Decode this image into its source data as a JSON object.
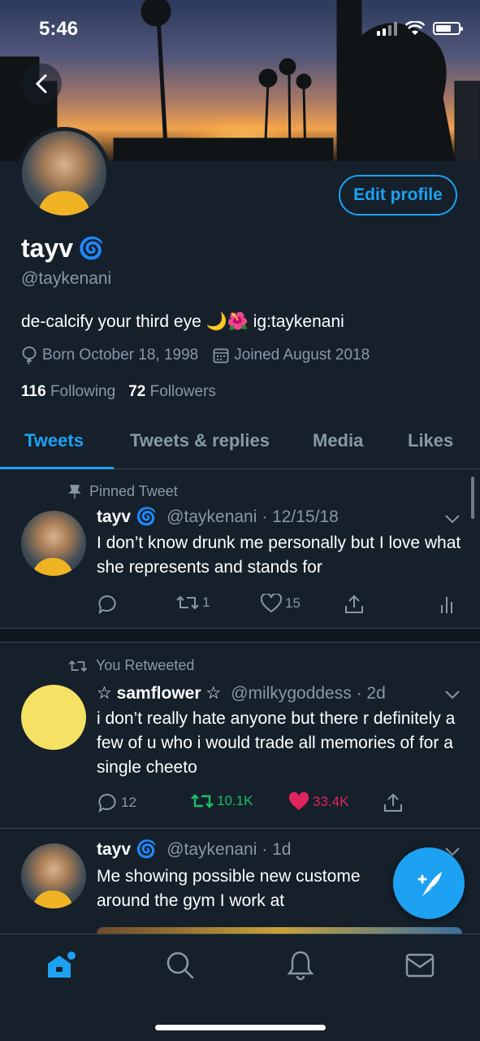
{
  "status_bar": {
    "time": "5:46"
  },
  "profile": {
    "name": "tayv",
    "name_emoji": "🌀",
    "handle": "@taykenani",
    "bio": "de-calcify your third eye 🌙🌺 ig:taykenani",
    "born": "Born October 18, 1998",
    "joined": "Joined August 2018",
    "following_count": "116",
    "following_label": "Following",
    "followers_count": "72",
    "followers_label": "Followers",
    "edit_label": "Edit profile"
  },
  "tabs": [
    {
      "label": "Tweets",
      "active": true
    },
    {
      "label": "Tweets & replies",
      "active": false
    },
    {
      "label": "Media",
      "active": false
    },
    {
      "label": "Likes",
      "active": false
    }
  ],
  "tweets": [
    {
      "context": "Pinned Tweet",
      "name": "tayv",
      "emoji": "🌀",
      "handle_time": "@taykenani · 12/15/18",
      "text": "I don’t know drunk me personally but I love what she represents and stands for",
      "replies": "",
      "retweets": "1",
      "likes": "15"
    },
    {
      "context": "You Retweeted",
      "name": "☆ samflower ☆",
      "handle_time": "@milkygoddess · 2d",
      "text": "i don’t really hate anyone but there r definitely a few of u who i would trade all memories of for a single cheeto",
      "replies": "12",
      "retweets": "10.1K",
      "likes": "33.4K"
    },
    {
      "name": "tayv",
      "emoji": "🌀",
      "handle_time": "@taykenani · 1d",
      "text": "Me showing possible new custome around the gym I work at"
    }
  ],
  "colors": {
    "accent": "#1da1f2",
    "background": "#15202b",
    "muted": "#8899a6",
    "retweet_green": "#17bf63",
    "like_pink": "#e0245e"
  }
}
